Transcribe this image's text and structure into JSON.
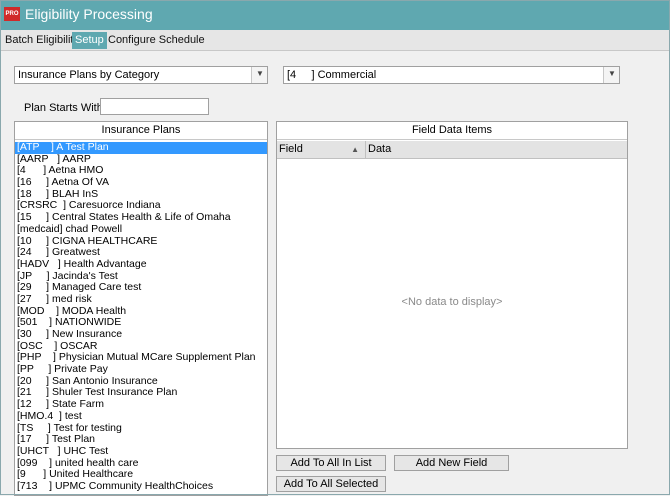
{
  "window": {
    "title": "Eligibility Processing",
    "app_icon": "app-logo-icon"
  },
  "tabs": [
    {
      "label": "Batch Eligibility"
    },
    {
      "label": "Setup"
    },
    {
      "label": "Configure Schedule"
    }
  ],
  "active_tab": "Setup",
  "filters": {
    "category_mode": "Insurance Plans by Category",
    "category_value": "[4     ] Commercial",
    "plan_starts_with_label": "Plan Starts With:",
    "plan_starts_with_value": ""
  },
  "insurance_plans": {
    "header": "Insurance Plans",
    "selected_index": 0,
    "items": [
      "[ATP    ] A Test Plan",
      "[AARP   ] AARP",
      "[4      ] Aetna HMO",
      "[16     ] Aetna Of VA",
      "[18     ] BLAH InS",
      "[CRSRC  ] Caresuorce Indiana",
      "[15     ] Central States Health & Life of Omaha",
      "[medcaid] chad Powell",
      "[10     ] CIGNA HEALTHCARE",
      "[24     ] Greatwest",
      "[HADV   ] Health Advantage",
      "[JP     ] Jacinda's Test",
      "[29     ] Managed Care test",
      "[27     ] med risk",
      "[MOD    ] MODA Health",
      "[501    ] NATIONWIDE",
      "[30     ] New Insurance",
      "[OSC    ] OSCAR",
      "[PHP    ] Physician Mutual MCare Supplement Plan",
      "[PP     ] Private Pay",
      "[20     ] San Antonio Insurance",
      "[21     ] Shuler Test Insurance Plan",
      "[12     ] State Farm",
      "[HMO.4  ] test",
      "[TS     ] Test for testing",
      "[17     ] Test Plan",
      "[UHCT   ] UHC Test",
      "[099    ] united health care",
      "[9      ] United Healthcare",
      "[713    ] UPMC Community HealthChoices"
    ]
  },
  "field_data_items": {
    "header": "Field Data Items",
    "columns": [
      "Field",
      "Data"
    ],
    "empty_text": "<No data to display>"
  },
  "buttons": {
    "add_to_all_in_list": "Add To All In List",
    "add_new_field": "Add New Field",
    "add_to_all_selected": "Add To All Selected"
  },
  "colors": {
    "titlebar": "#5fa8b0",
    "active_tab": "#5fa8b0",
    "selection": "#3399ff"
  }
}
